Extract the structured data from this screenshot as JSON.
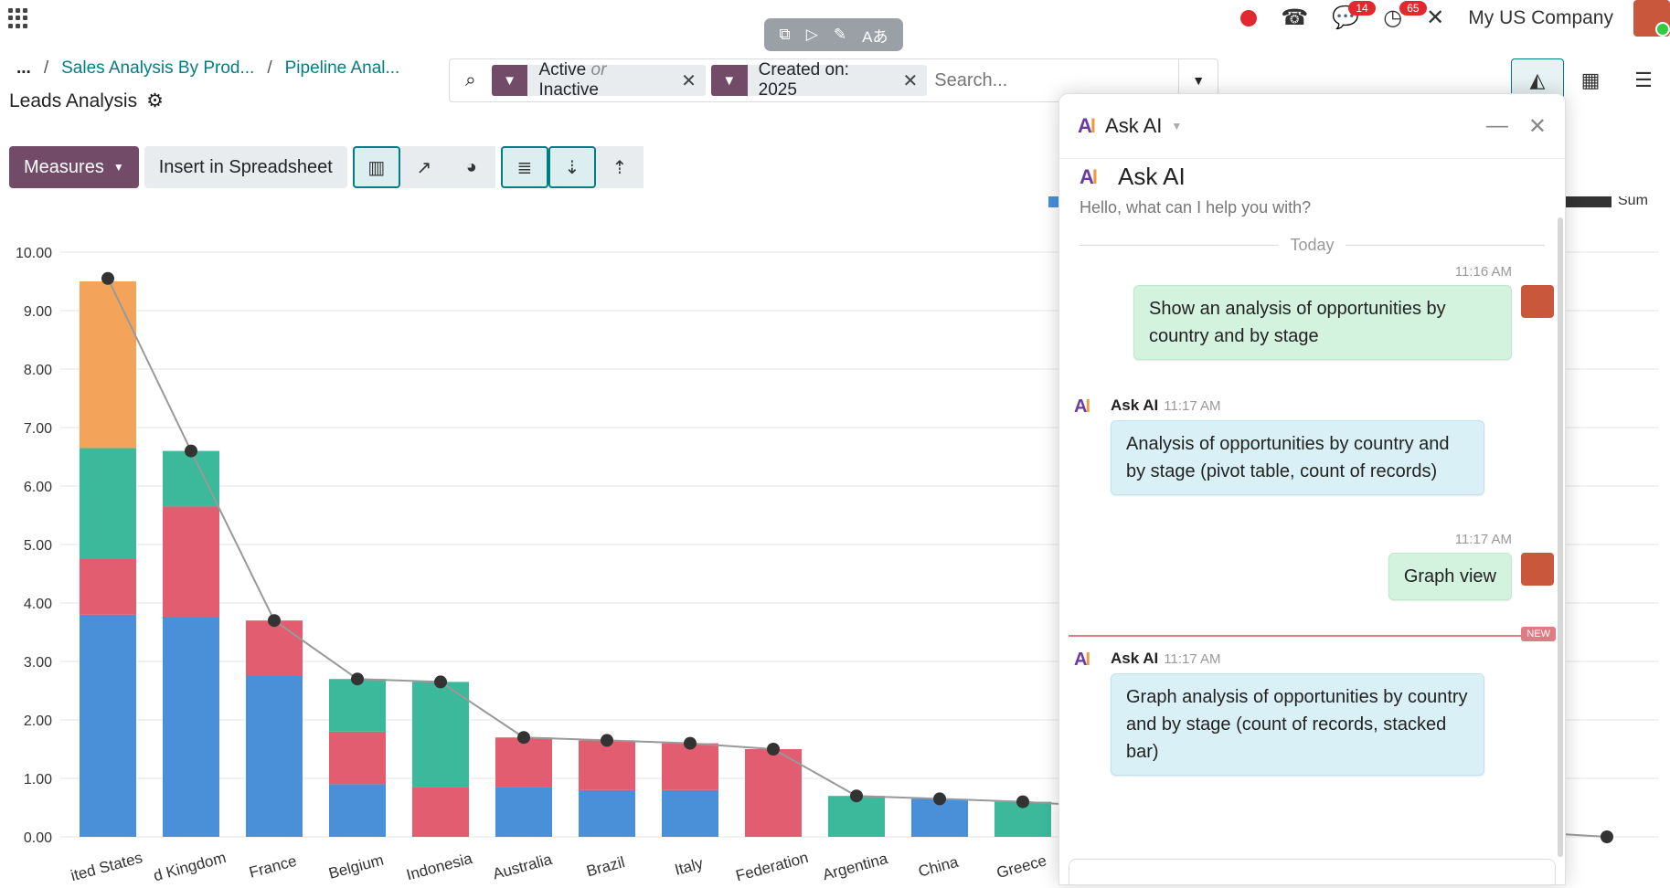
{
  "navbar": {
    "company": "My US Company",
    "messages_count": "14",
    "activities_count": "65",
    "icons": [
      "apps-icon",
      "record-dot-icon",
      "phone-icon",
      "chat-icon",
      "clock-icon",
      "tools-icon",
      "user-avatar"
    ]
  },
  "breadcrumb": {
    "more": "...",
    "items": [
      "Sales Analysis By Prod...",
      "Pipeline Anal..."
    ],
    "current": "Leads Analysis"
  },
  "search": {
    "facets": [
      {
        "value_a": "Active",
        "connector": "or",
        "value_b": "Inactive"
      },
      {
        "value": "Created on: 2025"
      }
    ],
    "placeholder": "Search..."
  },
  "toolbar": {
    "measures_label": "Measures",
    "insert_label": "Insert in Spreadsheet"
  },
  "chart_data": {
    "type": "bar",
    "stacked": true,
    "ylim": [
      0,
      10
    ],
    "yticks": [
      "0.00",
      "1.00",
      "2.00",
      "3.00",
      "4.00",
      "5.00",
      "6.00",
      "7.00",
      "8.00",
      "9.00",
      "10.00"
    ],
    "categories": [
      "United States",
      "United Kingdom",
      "France",
      "Belgium",
      "Indonesia",
      "Australia",
      "Brazil",
      "Italy",
      "Russian Federation",
      "Argentina",
      "China",
      "Greece",
      "Venezuela"
    ],
    "visible_tick_labels": [
      "ited States",
      "d Kingdom",
      "France",
      "Belgium",
      "Indonesia",
      "Australia",
      "Brazil",
      "Italy",
      "Federation",
      "Argentina",
      "China",
      "Greece",
      "ezuela"
    ],
    "series": [
      {
        "color": "#4a90d9",
        "values": [
          3.8,
          3.75,
          2.75,
          0.9,
          0,
          0.85,
          0.8,
          0.8,
          0,
          0,
          0.65,
          0,
          0
        ]
      },
      {
        "color": "#e25d6f",
        "values": [
          0.95,
          1.9,
          0.95,
          0.9,
          0.85,
          0.85,
          0.85,
          0.8,
          1.5,
          0,
          0,
          0,
          0
        ]
      },
      {
        "color": "#3bb99a",
        "values": [
          1.9,
          0.95,
          0,
          0.9,
          1.8,
          0,
          0,
          0,
          0,
          0.7,
          0,
          0.6,
          0
        ]
      },
      {
        "color": "#f4a35b",
        "values": [
          2.85,
          0,
          0,
          0,
          0,
          0,
          0,
          0,
          0,
          0,
          0,
          0,
          0
        ]
      },
      {
        "name": "Sum",
        "type": "line",
        "color": "#333333",
        "values": [
          9.55,
          6.6,
          3.7,
          2.7,
          2.65,
          1.7,
          1.65,
          1.6,
          1.5,
          0.7,
          0.65,
          0.6,
          0.0
        ]
      }
    ],
    "grid": true,
    "legend": "top-right"
  },
  "ai_panel": {
    "title": "Ask AI",
    "intro_name": "Ask AI",
    "intro_sub": "Hello, what can I help you with?",
    "day_separator": "Today",
    "messages": [
      {
        "author": "user",
        "time": "11:16 AM",
        "text": "Show an analysis of opportunities by country and by stage"
      },
      {
        "author": "Ask AI",
        "time": "11:17 AM",
        "text": "Analysis of opportunities by country and by stage (pivot table, count of records)"
      },
      {
        "author": "user",
        "time": "11:17 AM",
        "text": "Graph view"
      },
      {
        "author": "Ask AI",
        "time": "11:17 AM",
        "text": "Graph analysis of opportunities by country and by stage (count of records, stacked bar)"
      }
    ],
    "new_tag": "NEW"
  }
}
